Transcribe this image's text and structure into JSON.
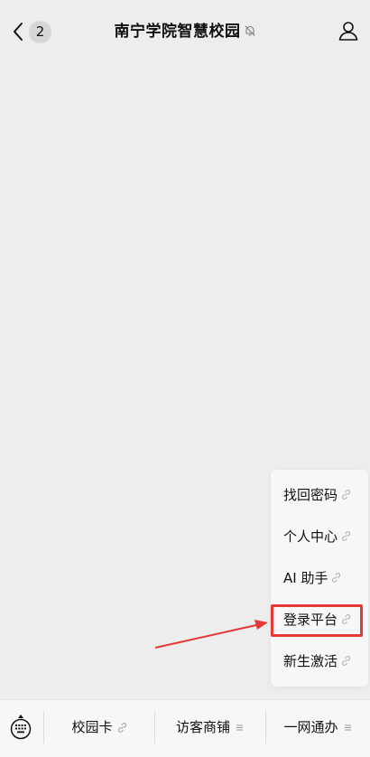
{
  "header": {
    "title": "南宁学院智慧校园",
    "unread_count": "2",
    "back_icon": "chevron-left-icon",
    "mute_icon": "bell-off-icon",
    "profile_icon": "person-icon"
  },
  "popup_menu": {
    "items": [
      {
        "label": "找回密码",
        "icon": "link-icon"
      },
      {
        "label": "个人中心",
        "icon": "link-icon"
      },
      {
        "label": "AI 助手",
        "icon": "link-icon"
      },
      {
        "label": "登录平台",
        "icon": "link-icon",
        "highlighted": true
      },
      {
        "label": "新生激活",
        "icon": "link-icon"
      }
    ]
  },
  "bottom_menu": {
    "keyboard_icon": "keyboard-icon",
    "tabs": [
      {
        "label": "校园卡",
        "icon": "link-icon"
      },
      {
        "label": "访客商铺",
        "icon": "menu-lines-icon"
      },
      {
        "label": "一网通办",
        "icon": "menu-lines-icon"
      }
    ]
  },
  "colors": {
    "background": "#ededed",
    "menu_background": "#f7f7f7",
    "highlight": "#e53935",
    "badge": "#d6d6d6"
  }
}
